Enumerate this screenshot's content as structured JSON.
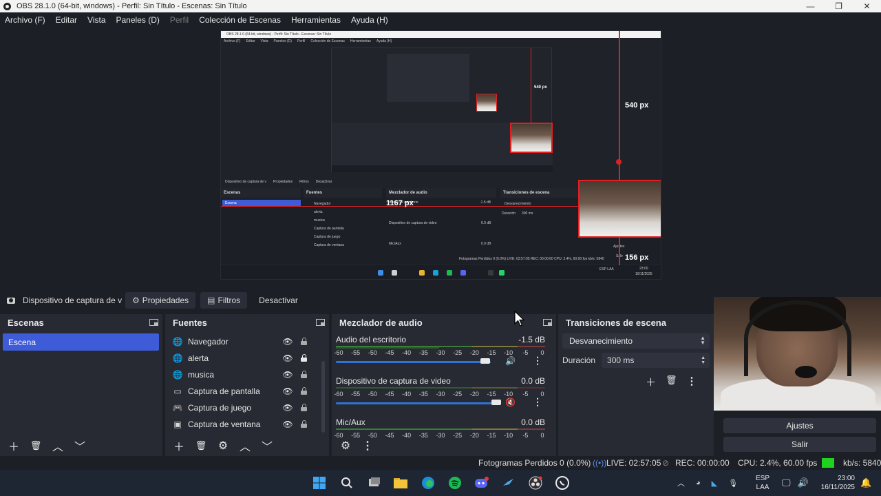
{
  "window": {
    "title": "OBS 28.1.0 (64-bit, windows) - Perfil: Sin Título - Escenas: Sin Título",
    "minimize": "—",
    "maximize": "❐",
    "close": "✕"
  },
  "menu": [
    {
      "label": "Archivo (F)",
      "enabled": true
    },
    {
      "label": "Editar",
      "enabled": true
    },
    {
      "label": "Vista",
      "enabled": true
    },
    {
      "label": "Paneles (D)",
      "enabled": true
    },
    {
      "label": "Perfil",
      "enabled": false
    },
    {
      "label": "Colección de Escenas",
      "enabled": true
    },
    {
      "label": "Herramientas",
      "enabled": true
    },
    {
      "label": "Ayuda (H)",
      "enabled": true
    }
  ],
  "preview": {
    "labels": {
      "height_main": "540 px",
      "height_inner": "540 px",
      "width_main": "1167 px",
      "offset_main": "156 px"
    },
    "nested_title": "OBS 28.1.0 (64-bit, windows) - Perfil: Sin Título - Escenas: Sin Título",
    "nested_menu": [
      "Archivo (F)",
      "Editar",
      "Vista",
      "Paneles (D)",
      "Perfil",
      "Colección de Escenas",
      "Herramientas",
      "Ayuda (H)"
    ],
    "nested_panels": {
      "scenes": "Escenas",
      "sources": "Fuentes",
      "mixer": "Mezclador de audio",
      "transitions": "Transiciones de escena",
      "scene": "Escena"
    },
    "nested_sources": [
      "Navegador",
      "alerta",
      "musica",
      "Captura de pantalla",
      "Captura de juego",
      "Captura de ventana"
    ],
    "nested_toolbar": [
      "Dispositivo de captura de v",
      "Propiedades",
      "Filtros",
      "Desactivar"
    ],
    "nested_mixer": {
      "ch1": "Audio del escritorio",
      "ch1_db": "-1.5 dB",
      "ch2": "Dispositivo de captura de video",
      "ch2_db": "0.0 dB",
      "ch3": "Mic/Aux",
      "ch3_db": "0.0 dB"
    },
    "nested_transitions": {
      "select": "Desvanecimiento",
      "duration_label": "Duración",
      "duration": "300 ms"
    },
    "nested_side_buttons": [
      "Ajustes",
      "Salir"
    ],
    "nested_status": "Fotogramas Perdidos 0 (0.0%)   LIVE: 02:57:05   REC: 00:00:00   CPU: 2.4%, 60.00 fps   kb/s: 5840",
    "nested_clock": {
      "lang": "ESP LAA",
      "time": "23:00",
      "date": "16/11/2025"
    }
  },
  "source_toolbar": {
    "source_name": "Dispositivo de captura de v",
    "properties": "Propiedades",
    "filters": "Filtros",
    "deactivate": "Desactivar"
  },
  "scenes_dock": {
    "title": "Escenas",
    "items": [
      "Escena"
    ]
  },
  "sources_dock": {
    "title": "Fuentes",
    "items": [
      {
        "name": "Navegador",
        "icon": "globe-icon",
        "locked": false
      },
      {
        "name": "alerta",
        "icon": "globe-icon",
        "locked": true
      },
      {
        "name": "musica",
        "icon": "globe-icon",
        "locked": false
      },
      {
        "name": "Captura de pantalla",
        "icon": "monitor-icon",
        "locked": false
      },
      {
        "name": "Captura de juego",
        "icon": "gamepad-icon",
        "locked": false
      },
      {
        "name": "Captura de ventana",
        "icon": "window-icon",
        "locked": false
      }
    ]
  },
  "mixer_dock": {
    "title": "Mezclador de audio",
    "ticks": [
      "-60",
      "-55",
      "-50",
      "-45",
      "-40",
      "-35",
      "-30",
      "-25",
      "-20",
      "-15",
      "-10",
      "-5",
      "0"
    ],
    "channels": [
      {
        "name": "Audio del escritorio",
        "db": "-1.5 dB",
        "volume": 0.96,
        "muted": false
      },
      {
        "name": "Dispositivo de captura de video",
        "db": "0.0 dB",
        "volume": 1.0,
        "muted": true
      },
      {
        "name": "Mic/Aux",
        "db": "0.0 dB",
        "volume": 1.0,
        "muted": false
      }
    ]
  },
  "transitions_dock": {
    "title": "Transiciones de escena",
    "transition": "Desvanecimiento",
    "duration_label": "Duración",
    "duration": "300 ms"
  },
  "side_buttons": {
    "settings": "Ajustes",
    "exit": "Salir"
  },
  "status": {
    "dropped": "Fotogramas Perdidos 0 (0.0%)",
    "live": "LIVE: 02:57:05",
    "rec": "REC: 00:00:00",
    "cpu": "CPU: 2.4%, 60.00 fps",
    "kbps": "kb/s: 5840",
    "indicator_color": "#1fd21f"
  },
  "taskbar": {
    "lang": "ESP",
    "layout": "LAA",
    "time": "23:00",
    "date": "16/11/2025",
    "apps": [
      "windows-start-icon",
      "search-icon",
      "task-view-icon",
      "file-explorer-icon",
      "edge-icon",
      "spotify-icon",
      "discord-icon",
      "steam-icon",
      "obs-icon",
      "whatsapp-icon"
    ]
  },
  "colors": {
    "accent": "#3e5bd8",
    "background": "#1d1f26",
    "panel": "#272a33",
    "red_guide": "#e02020"
  }
}
